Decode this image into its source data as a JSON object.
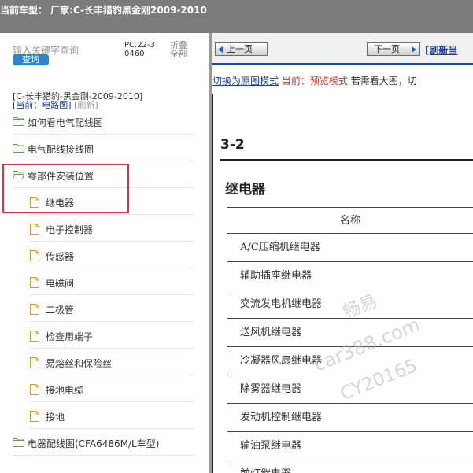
{
  "header": {
    "title": "当前车型：  厂家:C-长丰猎豹黑金刚2009-2010"
  },
  "sidebar": {
    "search_placeholder": "输入关键字查询",
    "search_button": "查询",
    "pc_code": "PC.22-30460",
    "collapse_all": "折叠全部",
    "car_label": "[C-长丰猎豹-黑金刚-2009-2010]",
    "current_prefix": "[当前：电路图]",
    "refresh": "[刷新]",
    "items": [
      {
        "label": "如何看电气配线图",
        "type": "folder"
      },
      {
        "label": "电气配线接线圈",
        "type": "folder"
      },
      {
        "label": "零部件安装位置",
        "type": "folder-open"
      },
      {
        "label": "继电器",
        "type": "doc"
      },
      {
        "label": "电子控制器",
        "type": "doc"
      },
      {
        "label": "传感器",
        "type": "doc"
      },
      {
        "label": "电磁阀",
        "type": "doc"
      },
      {
        "label": "二极管",
        "type": "doc"
      },
      {
        "label": "检查用端子",
        "type": "doc"
      },
      {
        "label": "易熔丝和保险丝",
        "type": "doc"
      },
      {
        "label": "接地电缆",
        "type": "doc"
      },
      {
        "label": "接地",
        "type": "doc"
      },
      {
        "label": "电器配线图(CFA6486M/L车型)",
        "type": "folder"
      }
    ]
  },
  "toolbar": {
    "prev": "上一页",
    "next": "下一页",
    "refresh": "[刷新当"
  },
  "modebar": {
    "switch_link": "切换为原图模式",
    "current": "当前：预览模式",
    "hint": "若需看大图，切"
  },
  "document": {
    "section": "3-2",
    "title": "继电器",
    "table_header": "名称",
    "rows": [
      "A/C压缩机继电器",
      "辅助插座继电器",
      "交流发电机继电器",
      "送风机继电器",
      "冷凝器风扇继电器",
      "除雾器继电器",
      "发动机控制继电器",
      "输油泵继电器",
      "前灯继电器"
    ],
    "watermark": [
      "畅易",
      "car388.com",
      "CY20165"
    ]
  },
  "colors": {
    "topbar": "#7b7b7b",
    "accent": "#2a86c8",
    "highlight": "#d8343a",
    "link": "#1a3d9c",
    "current_mode": "#c0392b"
  }
}
